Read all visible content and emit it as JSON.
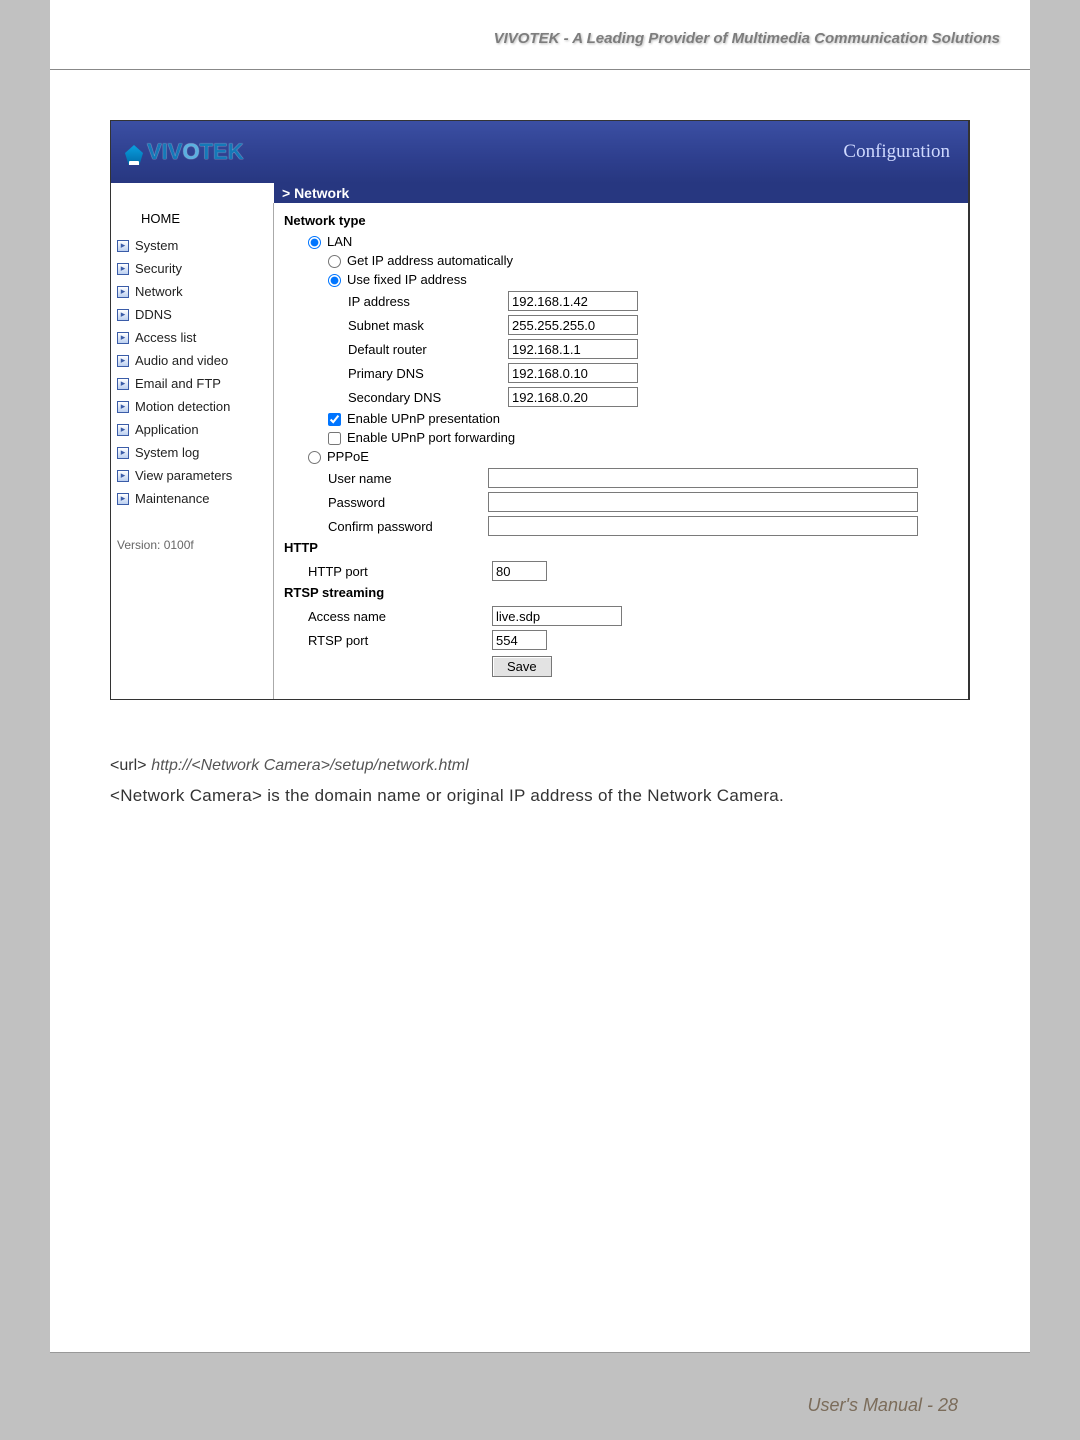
{
  "doc_header": "VIVOTEK - A Leading Provider of Multimedia Communication Solutions",
  "logo_text": "VIVOTEK",
  "config_label": "Configuration",
  "breadcrumb": "> Network",
  "sidebar": {
    "home": "HOME",
    "items": [
      "System",
      "Security",
      "Network",
      "DDNS",
      "Access list",
      "Audio and video",
      "Email and FTP",
      "Motion detection",
      "Application",
      "System log",
      "View parameters",
      "Maintenance"
    ],
    "version": "Version: 0100f"
  },
  "content": {
    "network_type": "Network type",
    "lan": "LAN",
    "get_ip_auto": "Get IP address automatically",
    "use_fixed": "Use fixed IP address",
    "ip_address_lbl": "IP address",
    "ip_address_val": "192.168.1.42",
    "subnet_lbl": "Subnet mask",
    "subnet_val": "255.255.255.0",
    "router_lbl": "Default router",
    "router_val": "192.168.1.1",
    "pdns_lbl": "Primary DNS",
    "pdns_val": "192.168.0.10",
    "sdns_lbl": "Secondary DNS",
    "sdns_val": "192.168.0.20",
    "upnp_present": "Enable UPnP presentation",
    "upnp_port": "Enable UPnP port forwarding",
    "pppoe": "PPPoE",
    "user_name_lbl": "User name",
    "user_name_val": "",
    "password_lbl": "Password",
    "password_val": "",
    "confirm_lbl": "Confirm password",
    "confirm_val": "",
    "http_hdr": "HTTP",
    "http_port_lbl": "HTTP port",
    "http_port_val": "80",
    "rtsp_hdr": "RTSP streaming",
    "access_lbl": "Access name",
    "access_val": "live.sdp",
    "rtsp_port_lbl": "RTSP port",
    "rtsp_port_val": "554",
    "save": "Save"
  },
  "below": {
    "url_prefix": "<url>",
    "url_path": "http://<Network Camera>/setup/network.html",
    "desc": "<Network Camera> is the domain name or original IP address of the Network Camera."
  },
  "footer": "User's Manual - 28"
}
